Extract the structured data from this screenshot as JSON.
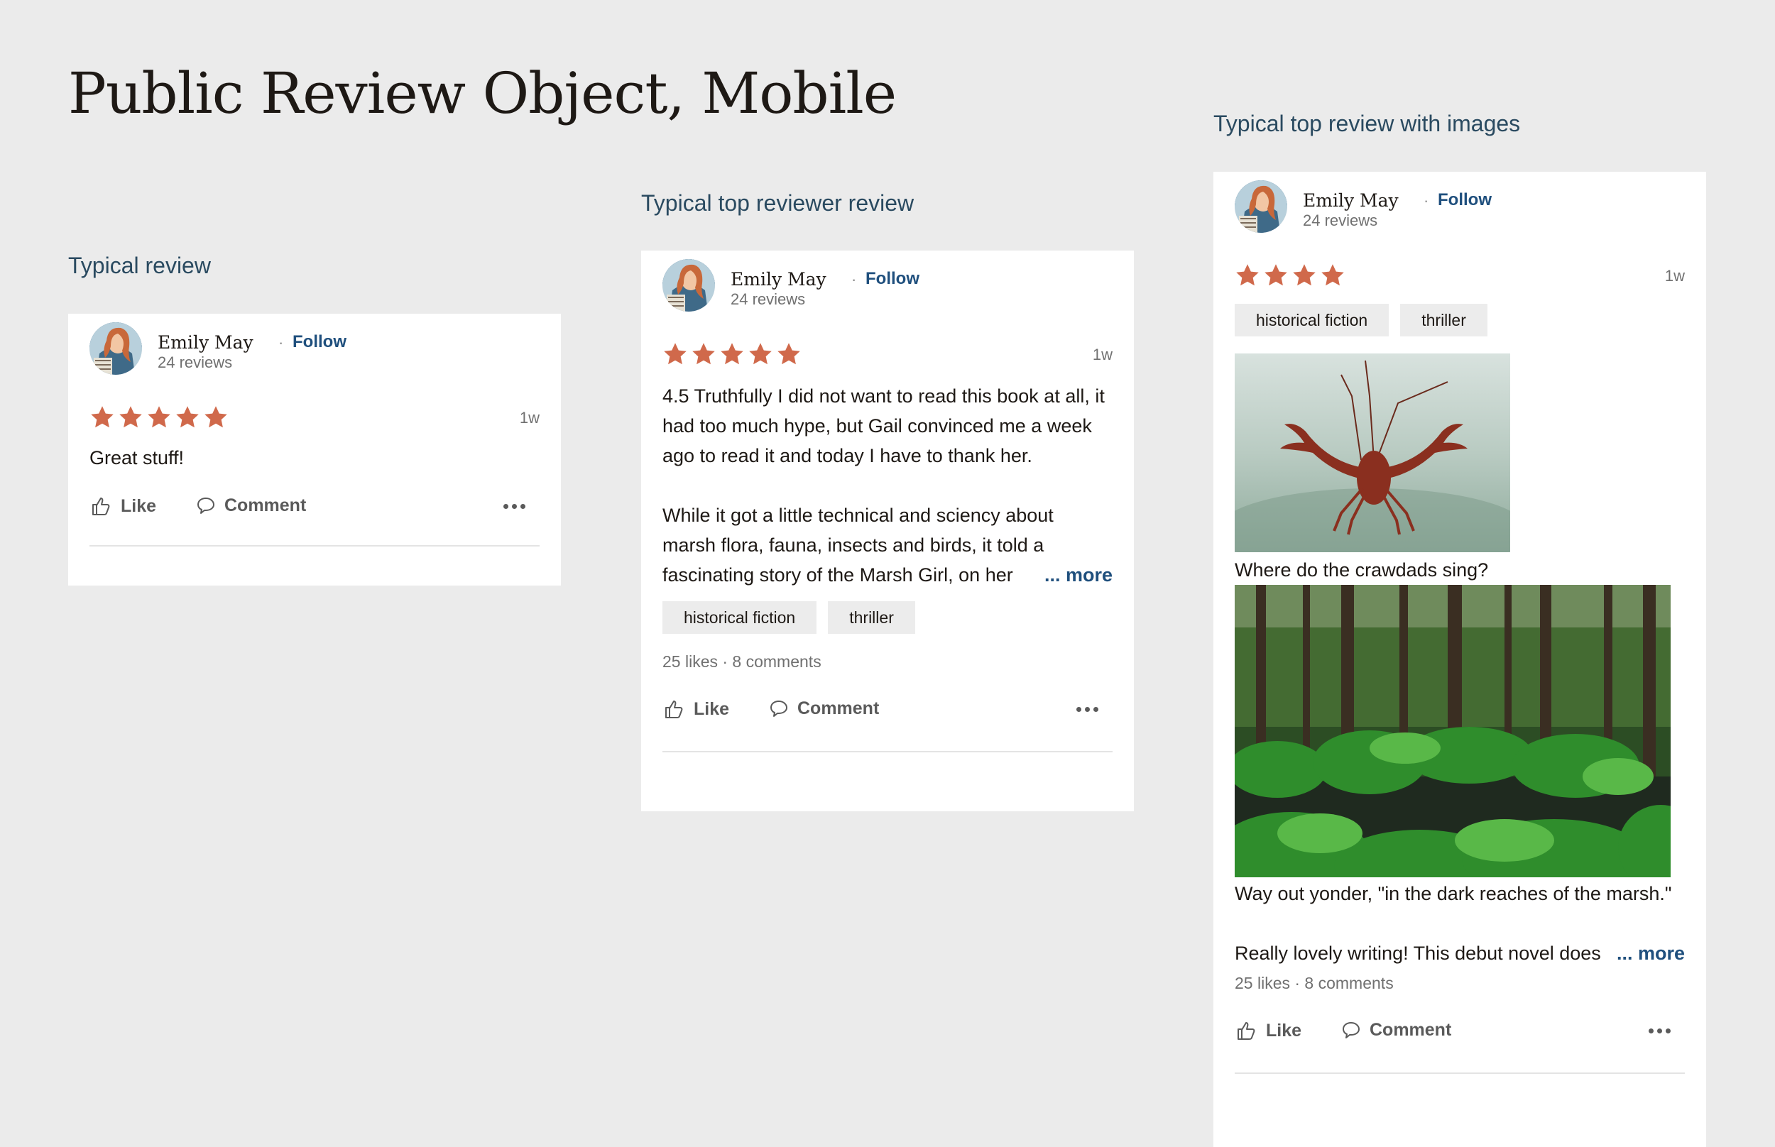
{
  "page": {
    "title": "Public Review Object, Mobile"
  },
  "colors": {
    "background": "#ebebeb",
    "star": "#d0694b",
    "link": "#1f4f7d",
    "label": "#2a4a60"
  },
  "icons": {
    "star": "star-icon",
    "like": "thumbs-up-icon",
    "comment": "speech-bubble-icon",
    "more": "more-horizontal-icon"
  },
  "sections": [
    {
      "label": "Typical review",
      "author": {
        "name": "Emily May",
        "reviews": "24 reviews",
        "follow": "Follow"
      },
      "rating": 5,
      "time": "1w",
      "body": "Great stuff!",
      "actions": {
        "like": "Like",
        "comment": "Comment"
      }
    },
    {
      "label": "Typical top reviewer review",
      "author": {
        "name": "Emily May",
        "reviews": "24 reviews",
        "follow": "Follow"
      },
      "rating": 5,
      "time": "1w",
      "paragraph1": "4.5 Truthfully I did not want to read this book at all, it had too much hype, but Gail convinced me a week ago to read it and today I have to thank her.",
      "paragraph2_lines": [
        "While it got a little technical and sciency about",
        "marsh flora, fauna, insects and birds, it told a"
      ],
      "paragraph2_truncated": "fascinating story of the Marsh Girl, on her",
      "more": "... more",
      "tags": [
        "historical fiction",
        "thriller"
      ],
      "counts": "25 likes · 8 comments",
      "actions": {
        "like": "Like",
        "comment": "Comment"
      }
    },
    {
      "label": "Typical top review with images",
      "author": {
        "name": "Emily May",
        "reviews": "24 reviews",
        "follow": "Follow"
      },
      "rating": 4,
      "time": "1w",
      "tags": [
        "historical fiction",
        "thriller"
      ],
      "image1_caption": "Where do the crawdads sing?",
      "image2_caption": "Way out yonder, \"in the dark reaches of the marsh.\"",
      "truncated": "Really lovely writing! This debut novel does",
      "more": "... more",
      "counts": "25 likes · 8 comments",
      "actions": {
        "like": "Like",
        "comment": "Comment"
      }
    }
  ]
}
